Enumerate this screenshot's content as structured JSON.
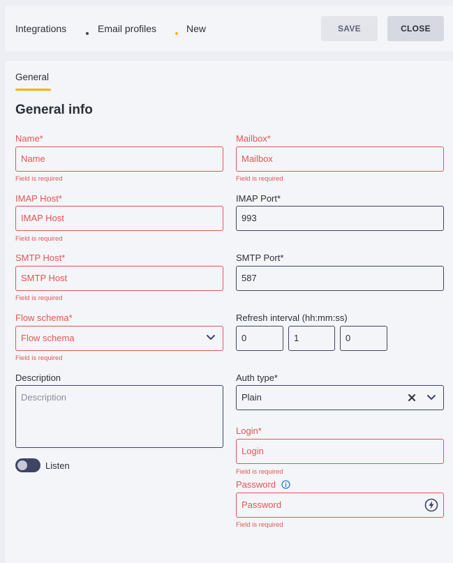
{
  "breadcrumb": {
    "items": [
      "Integrations",
      "Email profiles",
      "New"
    ],
    "dot_colors": [
      "#3e4466",
      "#f5b400"
    ]
  },
  "toolbar": {
    "save_label": "SAVE",
    "close_label": "CLOSE"
  },
  "tabs": {
    "general": "General"
  },
  "section": {
    "title": "General info"
  },
  "form": {
    "name": {
      "label": "Name*",
      "placeholder": "Name",
      "error": "Field is required"
    },
    "mailbox": {
      "label": "Mailbox*",
      "placeholder": "Mailbox",
      "error": "Field is required"
    },
    "imap_host": {
      "label": "IMAP Host*",
      "placeholder": "IMAP Host",
      "error": "Field is required"
    },
    "imap_port": {
      "label": "IMAP Port*",
      "value": "993"
    },
    "smtp_host": {
      "label": "SMTP Host*",
      "placeholder": "SMTP Host",
      "error": "Field is required"
    },
    "smtp_port": {
      "label": "SMTP Port*",
      "value": "587"
    },
    "flow_schema": {
      "label": "Flow schema*",
      "placeholder": "Flow schema",
      "error": "Field is required"
    },
    "refresh_interval": {
      "label": "Refresh interval (hh:mm:ss)",
      "hours": "0",
      "minutes": "1",
      "seconds": "0"
    },
    "description": {
      "label": "Description",
      "placeholder": "Description"
    },
    "auth_type": {
      "label": "Auth type*",
      "value": "Plain"
    },
    "login": {
      "label": "Login*",
      "placeholder": "Login",
      "error": "Field is required"
    },
    "password": {
      "label": "Password",
      "placeholder": "Password",
      "error": "Field is required"
    },
    "listen": {
      "label": "Listen",
      "enabled": false
    }
  },
  "colors": {
    "accent": "#f5b400",
    "error": "#e05555",
    "border": "#3e4466"
  },
  "icons": {
    "flow_schema_dropdown": "chevron-down-icon",
    "auth_clear": "close-icon",
    "auth_dropdown": "chevron-down-icon",
    "password_info": "info-icon",
    "password_generate": "lightning-icon"
  }
}
